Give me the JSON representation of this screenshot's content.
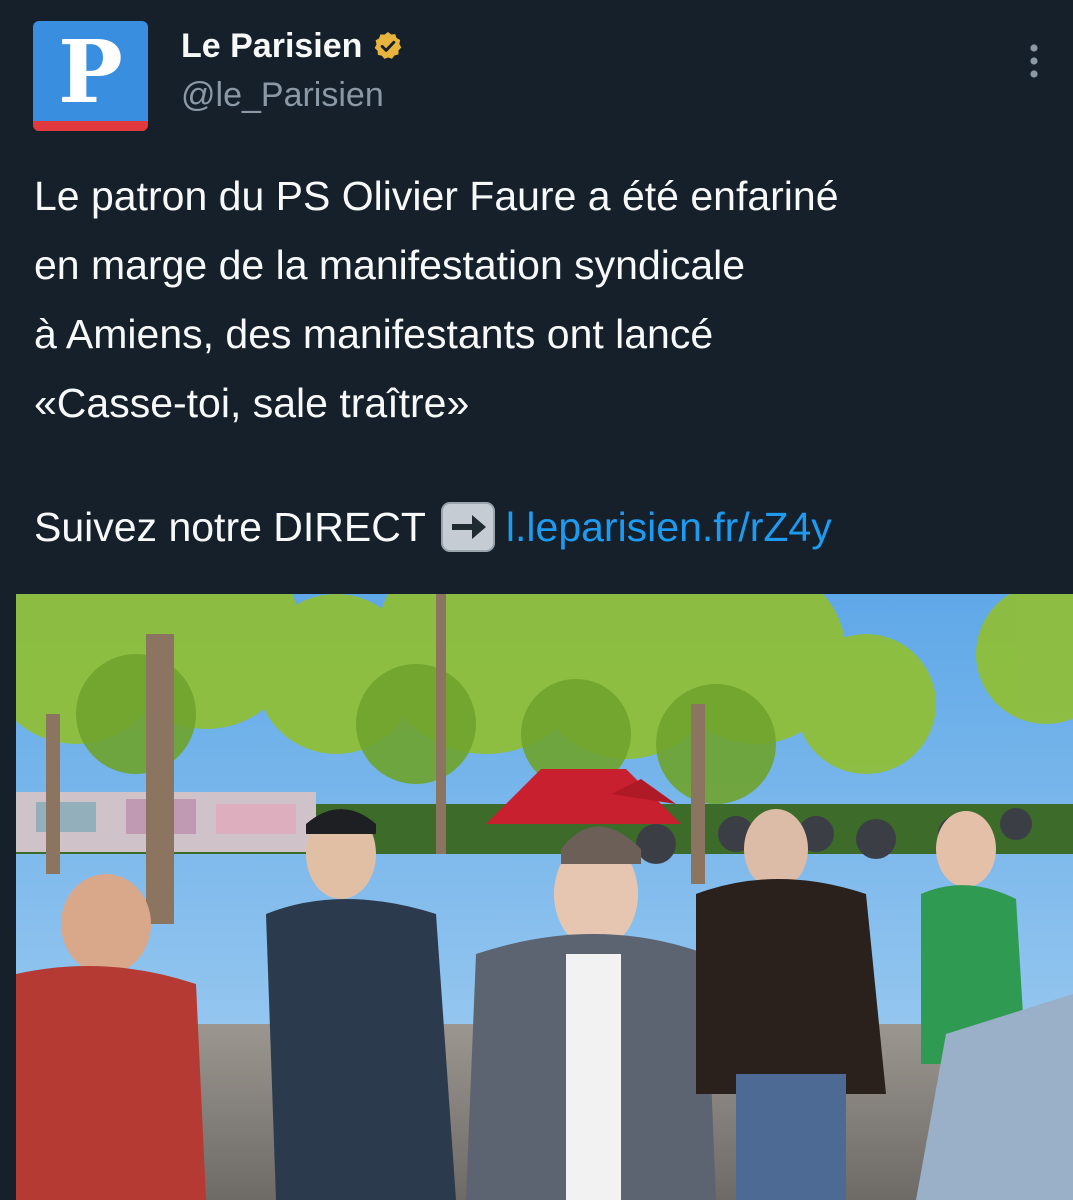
{
  "author": {
    "name": "Le Parisien",
    "handle": "@le_Parisien",
    "avatar_letter": "P",
    "verified": true,
    "verified_color": "#e7b53d",
    "avatar_color": "#3a8ee0",
    "avatar_stripe_color": "#e0393e"
  },
  "tweet": {
    "text": "Le patron du PS Olivier Faure a été enfariné\nen marge de la manifestation syndicale\nà Amiens, des manifestants ont lancé\n«Casse-toi, sale traître»",
    "follow_text": "Suivez notre DIRECT",
    "arrow_icon": "right-arrow-icon",
    "link_text": "l.leparisien.fr/rZ4y",
    "link_color": "#1d9bf0"
  },
  "media": {
    "type": "photo"
  },
  "colors": {
    "background": "#15202b",
    "text": "#f7f9f9",
    "secondary_text": "#8b98a5"
  }
}
